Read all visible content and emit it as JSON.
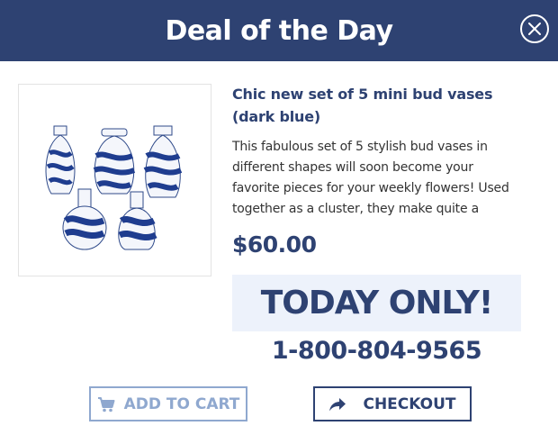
{
  "header": {
    "title": "Deal of the Day",
    "close_icon": "close-circle-icon"
  },
  "product": {
    "image_alt": "Set of 5 blue and white bud vases",
    "title": "Chic new set of 5 mini bud vases (dark blue)",
    "description": "This fabulous set of 5 stylish bud vases in different shapes will soon become your favorite pieces for your weekly flowers! Used together as a cluster, they make quite a",
    "price": "$60.00"
  },
  "promo": {
    "banner": "TODAY ONLY!",
    "phone": "1-800-804-9565"
  },
  "actions": {
    "add_to_cart": "ADD TO CART",
    "add_to_cart_icon": "cart-icon",
    "checkout": "CHECKOUT",
    "checkout_icon": "share-arrow-icon"
  },
  "colors": {
    "header_bg": "#2e4272",
    "accent": "#2e4272",
    "banner_bg": "#edf2fb",
    "cart_button": "#8fa8cf"
  }
}
